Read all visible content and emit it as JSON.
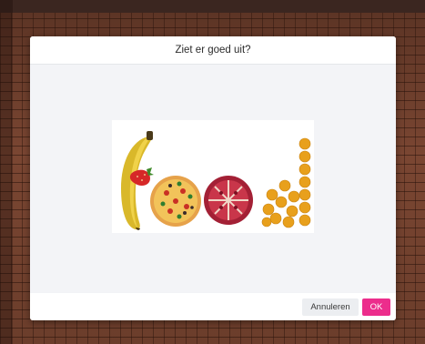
{
  "dialog": {
    "title": "Ziet er goed uit?",
    "image": {
      "word": "food",
      "letters": [
        "banana-f",
        "pizza-o",
        "pomegranate-o",
        "oranges-d"
      ]
    },
    "buttons": {
      "cancel_label": "Annuleren",
      "ok_label": "OK"
    }
  },
  "colors": {
    "accent": "#ec2d8c",
    "dialog_bg": "#f3f4f7",
    "background": "#6e3f2c"
  }
}
